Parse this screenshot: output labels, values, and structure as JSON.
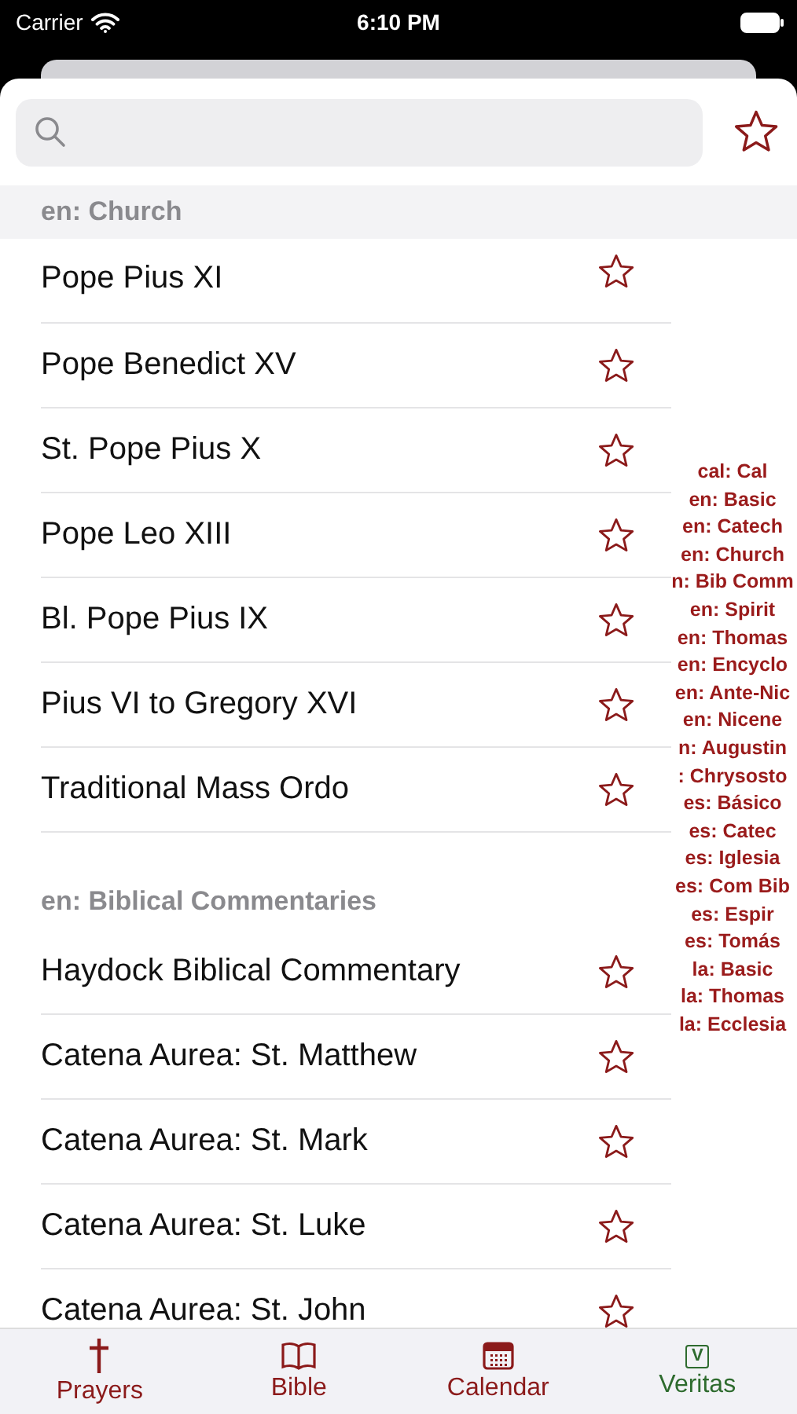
{
  "status_bar": {
    "carrier": "Carrier",
    "time": "6:10 PM"
  },
  "sections": [
    {
      "title": "en: Church",
      "rows": [
        {
          "title": "Pope Pius XI",
          "favorite": false
        },
        {
          "title": "Pope Benedict XV",
          "favorite": false
        },
        {
          "title": "St. Pope Pius X",
          "favorite": false
        },
        {
          "title": "Pope Leo XIII",
          "favorite": false
        },
        {
          "title": "Bl. Pope Pius IX",
          "favorite": false
        },
        {
          "title": "Pius VI to Gregory XVI",
          "favorite": false
        },
        {
          "title": "Traditional Mass Ordo",
          "favorite": false
        }
      ]
    },
    {
      "title": "en: Biblical Commentaries",
      "rows": [
        {
          "title": "Haydock Biblical Commentary",
          "favorite": false
        },
        {
          "title": "Catena Aurea: St. Matthew",
          "favorite": false
        },
        {
          "title": "Catena Aurea: St. Mark",
          "favorite": false
        },
        {
          "title": "Catena Aurea: St. Luke",
          "favorite": false
        },
        {
          "title": "Catena Aurea: St. John",
          "favorite": false
        }
      ]
    }
  ],
  "section_index": [
    "cal: Cal",
    "en: Basic",
    "en: Catech",
    "en: Church",
    "n: Bib Comm",
    "en: Spirit",
    "en: Thomas",
    "en: Encyclo",
    "en: Ante-Nic",
    "en: Nicene",
    "n: Augustin",
    ": Chrysosto",
    "es: Básico",
    "es: Catec",
    "es: Iglesia",
    "es: Com Bib",
    "es: Espir",
    "es: Tomás",
    "la: Basic",
    "la: Thomas",
    "la: Ecclesia"
  ],
  "tabs": [
    {
      "label": "Prayers",
      "kind": "cross",
      "color": "#8b1a1a"
    },
    {
      "label": "Bible",
      "kind": "book",
      "color": "#8b1a1a"
    },
    {
      "label": "Calendar",
      "kind": "calendar",
      "color": "#8b1a1a"
    },
    {
      "label": "Veritas",
      "kind": "letter",
      "icon_text": "V",
      "color": "#2e6b2e"
    }
  ]
}
